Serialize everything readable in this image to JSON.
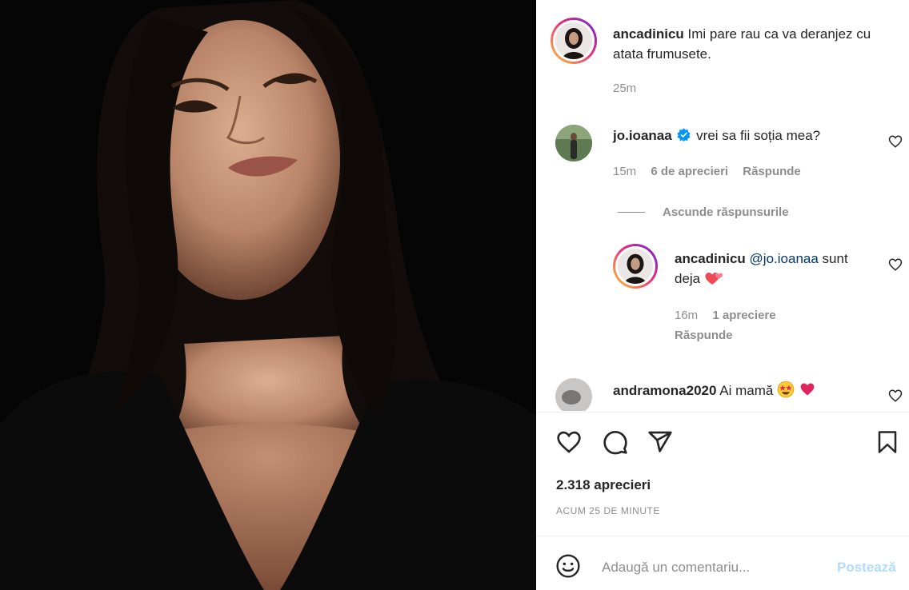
{
  "post": {
    "caption_user": "ancadinicu",
    "caption_text": "Imi pare rau ca va deranjez cu atata frumusete.",
    "caption_time": "25m"
  },
  "comments": [
    {
      "user": "jo.ioanaa",
      "text": "vrei sa fii soția mea?",
      "time": "15m",
      "likes": "6 de aprecieri",
      "reply_label": "Răspunde",
      "verified": true
    }
  ],
  "hide_replies_label": "Ascunde răspunsurile",
  "reply": {
    "user": "ancadinicu",
    "mention": "@jo.ioanaa",
    "text_a": "sunt",
    "text_b": "deja",
    "time": "16m",
    "likes": "1 apreciere",
    "reply_label": "Răspunde"
  },
  "comment2": {
    "user": "andramona2020",
    "text": "Ai mamă"
  },
  "stats": {
    "likes": "2.318 aprecieri",
    "time_ago": "ACUM 25 DE MINUTE"
  },
  "composer": {
    "placeholder": "Adaugă un comentariu...",
    "post_label": "Postează"
  },
  "colors": {
    "verified": "#0095f6",
    "heart_red": "#ed4956",
    "post_disabled": "#b3dbff"
  }
}
